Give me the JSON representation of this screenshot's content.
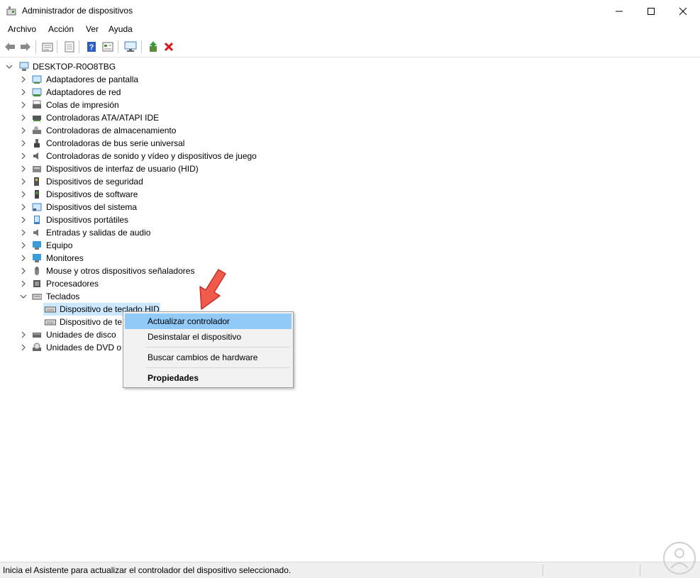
{
  "window": {
    "title": "Administrador de dispositivos"
  },
  "menu": [
    "Archivo",
    "Acción",
    "Ver",
    "Ayuda"
  ],
  "toolbar": {
    "icons": [
      "back-arrow-icon",
      "forward-arrow-icon",
      "properties-view-icon",
      "show-hidden-icon",
      "help-icon",
      "grid-view-icon",
      "monitor-scan-icon",
      "update-driver-icon",
      "uninstall-icon"
    ]
  },
  "tree": {
    "root": "DESKTOP-R0O8TBG",
    "categories": [
      {
        "label": "Adaptadores de pantalla",
        "icon": "display-adapter-icon"
      },
      {
        "label": "Adaptadores de red",
        "icon": "network-adapter-icon"
      },
      {
        "label": "Colas de impresión",
        "icon": "printer-queue-icon"
      },
      {
        "label": "Controladoras ATA/ATAPI IDE",
        "icon": "ide-controller-icon"
      },
      {
        "label": "Controladoras de almacenamiento",
        "icon": "storage-controller-icon"
      },
      {
        "label": "Controladoras de bus serie universal",
        "icon": "usb-icon"
      },
      {
        "label": "Controladoras de sonido y vídeo y dispositivos de juego",
        "icon": "speaker-icon"
      },
      {
        "label": "Dispositivos de interfaz de usuario (HID)",
        "icon": "hid-icon"
      },
      {
        "label": "Dispositivos de seguridad",
        "icon": "security-key-icon"
      },
      {
        "label": "Dispositivos de software",
        "icon": "software-device-icon"
      },
      {
        "label": "Dispositivos del sistema",
        "icon": "system-device-icon"
      },
      {
        "label": "Dispositivos portátiles",
        "icon": "portable-device-icon"
      },
      {
        "label": "Entradas y salidas de audio",
        "icon": "audio-io-icon"
      },
      {
        "label": "Equipo",
        "icon": "computer-icon"
      },
      {
        "label": "Monitores",
        "icon": "monitor-icon"
      },
      {
        "label": "Mouse y otros dispositivos señaladores",
        "icon": "mouse-icon"
      },
      {
        "label": "Procesadores",
        "icon": "processor-icon"
      },
      {
        "label": "Teclados",
        "icon": "keyboard-icon",
        "expanded": true
      },
      {
        "label": "Unidades de disco",
        "icon": "disk-drive-icon"
      },
      {
        "label": "Unidades de DVD o C",
        "icon": "dvd-drive-icon"
      }
    ],
    "keyboard_children": [
      "Dispositivo de teclado HID",
      "Dispositivo de te"
    ]
  },
  "context_menu": {
    "items": [
      "Actualizar controlador",
      "Desinstalar el dispositivo",
      "Buscar cambios de hardware",
      "Propiedades"
    ]
  },
  "status": {
    "text": "Inicia el Asistente para actualizar el controlador del dispositivo seleccionado."
  },
  "colors": {
    "selection": "#cce8ff",
    "menu_highlight": "#91c9f7",
    "arrow": "#f05a4a"
  }
}
